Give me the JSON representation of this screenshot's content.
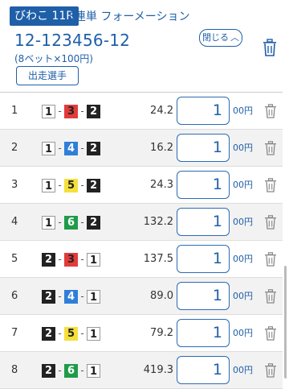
{
  "header": {
    "race": "びわこ 11R",
    "bet_type": "3連単 フォーメーション",
    "ticket_no": "12-123456-12",
    "summary": "(8ベット×100円)",
    "entries_button": "出走選手",
    "close_button": "閉じる"
  },
  "unit_suffix": "00円",
  "boat_colors": {
    "1": "white",
    "2": "black",
    "3": "red",
    "4": "blue",
    "5": "yellow",
    "6": "green"
  },
  "bets": [
    {
      "no": "1",
      "first": "1",
      "second": "3",
      "third": "2",
      "odds": "24.2",
      "amount": "1"
    },
    {
      "no": "2",
      "first": "1",
      "second": "4",
      "third": "2",
      "odds": "16.2",
      "amount": "1"
    },
    {
      "no": "3",
      "first": "1",
      "second": "5",
      "third": "2",
      "odds": "24.3",
      "amount": "1"
    },
    {
      "no": "4",
      "first": "1",
      "second": "6",
      "third": "2",
      "odds": "132.2",
      "amount": "1"
    },
    {
      "no": "5",
      "first": "2",
      "second": "3",
      "third": "1",
      "odds": "137.5",
      "amount": "1"
    },
    {
      "no": "6",
      "first": "2",
      "second": "4",
      "third": "1",
      "odds": "89.0",
      "amount": "1"
    },
    {
      "no": "7",
      "first": "2",
      "second": "5",
      "third": "1",
      "odds": "79.2",
      "amount": "1"
    },
    {
      "no": "8",
      "first": "2",
      "second": "6",
      "third": "1",
      "odds": "419.3",
      "amount": "1"
    }
  ]
}
